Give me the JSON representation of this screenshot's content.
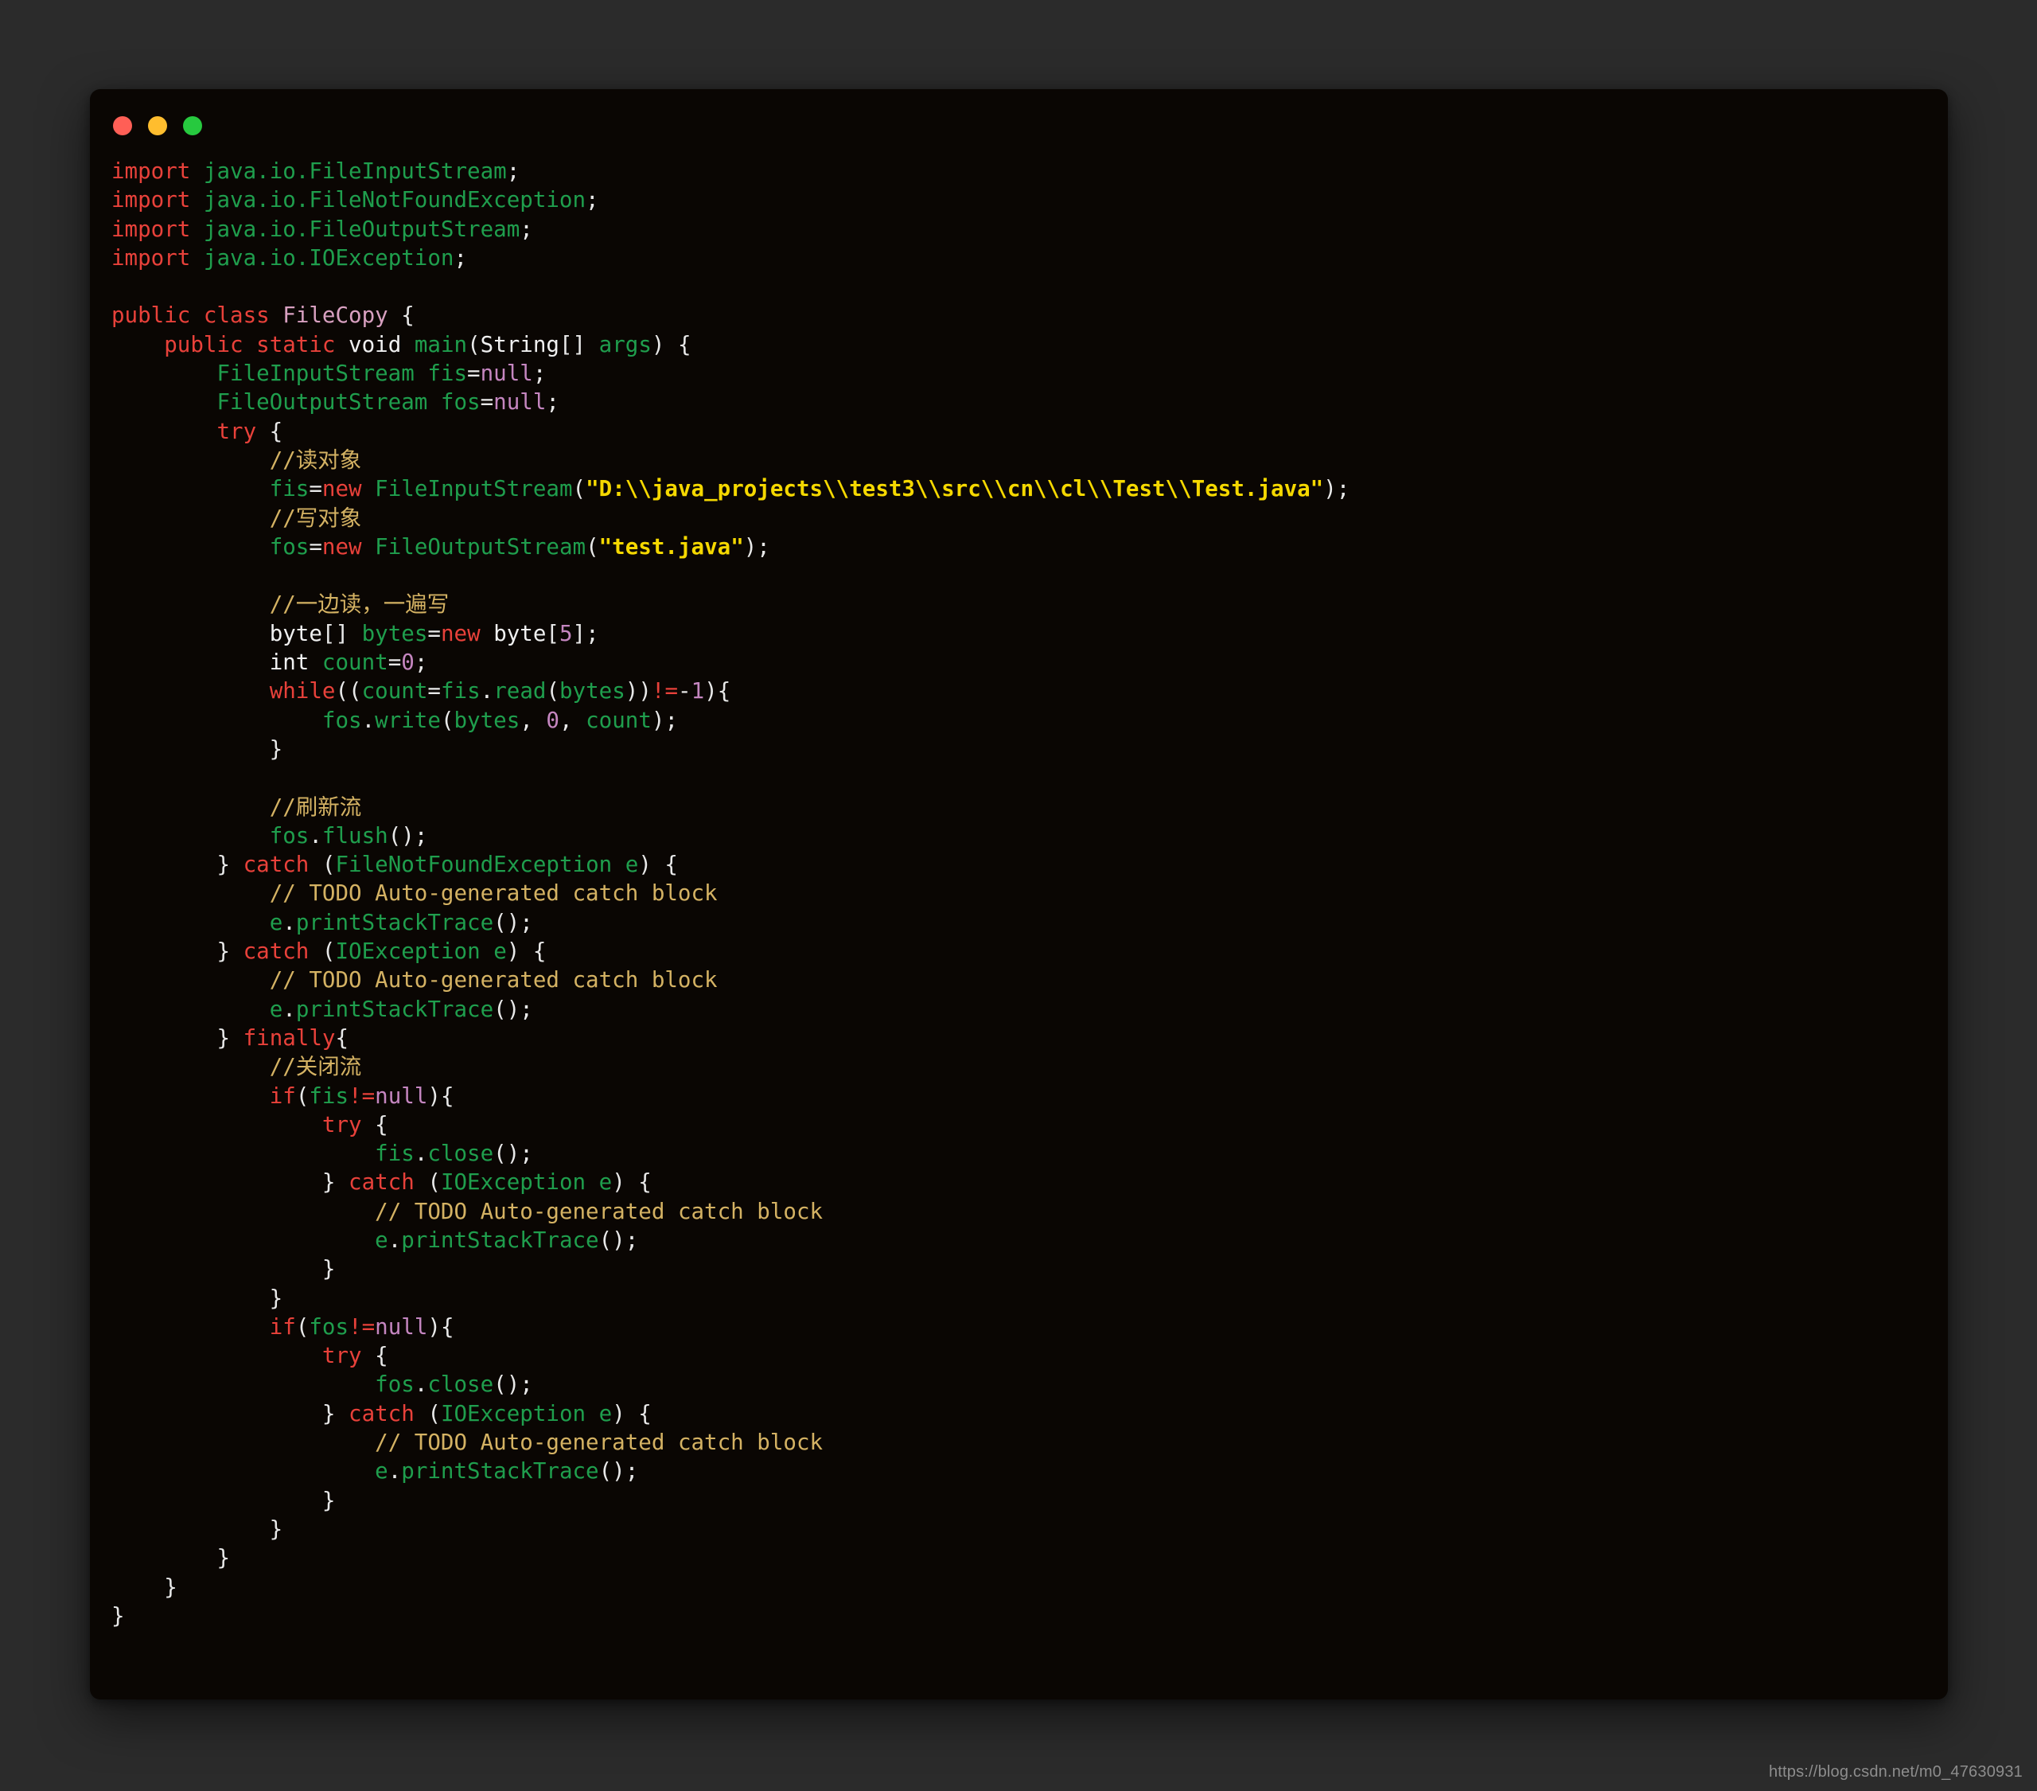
{
  "window": {
    "traffic_lights": [
      {
        "name": "close-button",
        "color": "#ff5f56"
      },
      {
        "name": "minimize-button",
        "color": "#ffbd2e"
      },
      {
        "name": "maximize-button",
        "color": "#27c93f"
      }
    ],
    "background": "#0a0603",
    "page_background": "#2b2b2b"
  },
  "watermark": {
    "text": "https://blog.csdn.net/m0_47630931"
  },
  "colors": {
    "keyword": "#e8413a",
    "type": "#1f9e4d",
    "class_name": "#d8a0c0",
    "string": "#f5d800",
    "number": "#c586c0",
    "comment": "#d4b263",
    "punctuation": "#e8e8e8",
    "primitive": "#f0f0f0"
  },
  "code": {
    "language": "java",
    "class_name": "FileCopy",
    "lines": [
      [
        {
          "t": "import",
          "c": "kw"
        },
        {
          "t": " ",
          "c": "pun"
        },
        {
          "t": "java.io.FileInputStream",
          "c": "typ"
        },
        {
          "t": ";",
          "c": "pun"
        }
      ],
      [
        {
          "t": "import",
          "c": "kw"
        },
        {
          "t": " ",
          "c": "pun"
        },
        {
          "t": "java.io.FileNotFoundException",
          "c": "typ"
        },
        {
          "t": ";",
          "c": "pun"
        }
      ],
      [
        {
          "t": "import",
          "c": "kw"
        },
        {
          "t": " ",
          "c": "pun"
        },
        {
          "t": "java.io.FileOutputStream",
          "c": "typ"
        },
        {
          "t": ";",
          "c": "pun"
        }
      ],
      [
        {
          "t": "import",
          "c": "kw"
        },
        {
          "t": " ",
          "c": "pun"
        },
        {
          "t": "java.io.IOException",
          "c": "typ"
        },
        {
          "t": ";",
          "c": "pun"
        }
      ],
      [],
      [
        {
          "t": "public",
          "c": "kw"
        },
        {
          "t": " ",
          "c": "pun"
        },
        {
          "t": "class",
          "c": "kw"
        },
        {
          "t": " ",
          "c": "pun"
        },
        {
          "t": "FileCopy",
          "c": "cls"
        },
        {
          "t": " {",
          "c": "pun"
        }
      ],
      [
        {
          "t": "    ",
          "c": "pun"
        },
        {
          "t": "public",
          "c": "kw"
        },
        {
          "t": " ",
          "c": "pun"
        },
        {
          "t": "static",
          "c": "kw"
        },
        {
          "t": " ",
          "c": "pun"
        },
        {
          "t": "void",
          "c": "prim"
        },
        {
          "t": " ",
          "c": "pun"
        },
        {
          "t": "main",
          "c": "typ"
        },
        {
          "t": "(",
          "c": "pun"
        },
        {
          "t": "String",
          "c": "prim"
        },
        {
          "t": "[] ",
          "c": "pun"
        },
        {
          "t": "args",
          "c": "typ"
        },
        {
          "t": ") {",
          "c": "pun"
        }
      ],
      [
        {
          "t": "        ",
          "c": "pun"
        },
        {
          "t": "FileInputStream",
          "c": "typ"
        },
        {
          "t": " ",
          "c": "pun"
        },
        {
          "t": "fis",
          "c": "typ"
        },
        {
          "t": "=",
          "c": "pun"
        },
        {
          "t": "null",
          "c": "num"
        },
        {
          "t": ";",
          "c": "pun"
        }
      ],
      [
        {
          "t": "        ",
          "c": "pun"
        },
        {
          "t": "FileOutputStream",
          "c": "typ"
        },
        {
          "t": " ",
          "c": "pun"
        },
        {
          "t": "fos",
          "c": "typ"
        },
        {
          "t": "=",
          "c": "pun"
        },
        {
          "t": "null",
          "c": "num"
        },
        {
          "t": ";",
          "c": "pun"
        }
      ],
      [
        {
          "t": "        ",
          "c": "pun"
        },
        {
          "t": "try",
          "c": "kw"
        },
        {
          "t": " {",
          "c": "pun"
        }
      ],
      [
        {
          "t": "            ",
          "c": "pun"
        },
        {
          "t": "//读对象",
          "c": "cmt"
        }
      ],
      [
        {
          "t": "            ",
          "c": "pun"
        },
        {
          "t": "fis",
          "c": "typ"
        },
        {
          "t": "=",
          "c": "pun"
        },
        {
          "t": "new",
          "c": "kw"
        },
        {
          "t": " ",
          "c": "pun"
        },
        {
          "t": "FileInputStream",
          "c": "typ"
        },
        {
          "t": "(",
          "c": "pun"
        },
        {
          "t": "\"D:\\\\java_projects\\\\test3\\\\src\\\\cn\\\\cl\\\\Test\\\\Test.java\"",
          "c": "str"
        },
        {
          "t": ");",
          "c": "pun"
        }
      ],
      [
        {
          "t": "            ",
          "c": "pun"
        },
        {
          "t": "//写对象",
          "c": "cmt"
        }
      ],
      [
        {
          "t": "            ",
          "c": "pun"
        },
        {
          "t": "fos",
          "c": "typ"
        },
        {
          "t": "=",
          "c": "pun"
        },
        {
          "t": "new",
          "c": "kw"
        },
        {
          "t": " ",
          "c": "pun"
        },
        {
          "t": "FileOutputStream",
          "c": "typ"
        },
        {
          "t": "(",
          "c": "pun"
        },
        {
          "t": "\"test.java\"",
          "c": "str"
        },
        {
          "t": ");",
          "c": "pun"
        }
      ],
      [],
      [
        {
          "t": "            ",
          "c": "pun"
        },
        {
          "t": "//一边读，一遍写",
          "c": "cmt"
        }
      ],
      [
        {
          "t": "            ",
          "c": "pun"
        },
        {
          "t": "byte",
          "c": "prim"
        },
        {
          "t": "[] ",
          "c": "pun"
        },
        {
          "t": "bytes",
          "c": "typ"
        },
        {
          "t": "=",
          "c": "pun"
        },
        {
          "t": "new",
          "c": "kw"
        },
        {
          "t": " ",
          "c": "pun"
        },
        {
          "t": "byte",
          "c": "prim"
        },
        {
          "t": "[",
          "c": "pun"
        },
        {
          "t": "5",
          "c": "num"
        },
        {
          "t": "];",
          "c": "pun"
        }
      ],
      [
        {
          "t": "            ",
          "c": "pun"
        },
        {
          "t": "int",
          "c": "prim"
        },
        {
          "t": " ",
          "c": "pun"
        },
        {
          "t": "count",
          "c": "typ"
        },
        {
          "t": "=",
          "c": "pun"
        },
        {
          "t": "0",
          "c": "num"
        },
        {
          "t": ";",
          "c": "pun"
        }
      ],
      [
        {
          "t": "            ",
          "c": "pun"
        },
        {
          "t": "while",
          "c": "kw"
        },
        {
          "t": "((",
          "c": "pun"
        },
        {
          "t": "count",
          "c": "typ"
        },
        {
          "t": "=",
          "c": "pun"
        },
        {
          "t": "fis",
          "c": "typ"
        },
        {
          "t": ".",
          "c": "pun"
        },
        {
          "t": "read",
          "c": "typ"
        },
        {
          "t": "(",
          "c": "pun"
        },
        {
          "t": "bytes",
          "c": "typ"
        },
        {
          "t": "))",
          "c": "pun"
        },
        {
          "t": "!=",
          "c": "kw"
        },
        {
          "t": "-",
          "c": "pun"
        },
        {
          "t": "1",
          "c": "num"
        },
        {
          "t": "){",
          "c": "pun"
        }
      ],
      [
        {
          "t": "                ",
          "c": "pun"
        },
        {
          "t": "fos",
          "c": "typ"
        },
        {
          "t": ".",
          "c": "pun"
        },
        {
          "t": "write",
          "c": "typ"
        },
        {
          "t": "(",
          "c": "pun"
        },
        {
          "t": "bytes",
          "c": "typ"
        },
        {
          "t": ", ",
          "c": "pun"
        },
        {
          "t": "0",
          "c": "num"
        },
        {
          "t": ", ",
          "c": "pun"
        },
        {
          "t": "count",
          "c": "typ"
        },
        {
          "t": ");",
          "c": "pun"
        }
      ],
      [
        {
          "t": "            }",
          "c": "pun"
        }
      ],
      [],
      [
        {
          "t": "            ",
          "c": "pun"
        },
        {
          "t": "//刷新流",
          "c": "cmt"
        }
      ],
      [
        {
          "t": "            ",
          "c": "pun"
        },
        {
          "t": "fos",
          "c": "typ"
        },
        {
          "t": ".",
          "c": "pun"
        },
        {
          "t": "flush",
          "c": "typ"
        },
        {
          "t": "();",
          "c": "pun"
        }
      ],
      [
        {
          "t": "        } ",
          "c": "pun"
        },
        {
          "t": "catch",
          "c": "kw"
        },
        {
          "t": " (",
          "c": "pun"
        },
        {
          "t": "FileNotFoundException",
          "c": "typ"
        },
        {
          "t": " ",
          "c": "pun"
        },
        {
          "t": "e",
          "c": "typ"
        },
        {
          "t": ") {",
          "c": "pun"
        }
      ],
      [
        {
          "t": "            ",
          "c": "pun"
        },
        {
          "t": "// TODO Auto-generated catch block",
          "c": "cmt"
        }
      ],
      [
        {
          "t": "            ",
          "c": "pun"
        },
        {
          "t": "e",
          "c": "typ"
        },
        {
          "t": ".",
          "c": "pun"
        },
        {
          "t": "printStackTrace",
          "c": "typ"
        },
        {
          "t": "();",
          "c": "pun"
        }
      ],
      [
        {
          "t": "        } ",
          "c": "pun"
        },
        {
          "t": "catch",
          "c": "kw"
        },
        {
          "t": " (",
          "c": "pun"
        },
        {
          "t": "IOException",
          "c": "typ"
        },
        {
          "t": " ",
          "c": "pun"
        },
        {
          "t": "e",
          "c": "typ"
        },
        {
          "t": ") {",
          "c": "pun"
        }
      ],
      [
        {
          "t": "            ",
          "c": "pun"
        },
        {
          "t": "// TODO Auto-generated catch block",
          "c": "cmt"
        }
      ],
      [
        {
          "t": "            ",
          "c": "pun"
        },
        {
          "t": "e",
          "c": "typ"
        },
        {
          "t": ".",
          "c": "pun"
        },
        {
          "t": "printStackTrace",
          "c": "typ"
        },
        {
          "t": "();",
          "c": "pun"
        }
      ],
      [
        {
          "t": "        } ",
          "c": "pun"
        },
        {
          "t": "finally",
          "c": "kw"
        },
        {
          "t": "{",
          "c": "pun"
        }
      ],
      [
        {
          "t": "            ",
          "c": "pun"
        },
        {
          "t": "//关闭流",
          "c": "cmt"
        }
      ],
      [
        {
          "t": "            ",
          "c": "pun"
        },
        {
          "t": "if",
          "c": "kw"
        },
        {
          "t": "(",
          "c": "pun"
        },
        {
          "t": "fis",
          "c": "typ"
        },
        {
          "t": "!=",
          "c": "kw"
        },
        {
          "t": "null",
          "c": "num"
        },
        {
          "t": "){",
          "c": "pun"
        }
      ],
      [
        {
          "t": "                ",
          "c": "pun"
        },
        {
          "t": "try",
          "c": "kw"
        },
        {
          "t": " {",
          "c": "pun"
        }
      ],
      [
        {
          "t": "                    ",
          "c": "pun"
        },
        {
          "t": "fis",
          "c": "typ"
        },
        {
          "t": ".",
          "c": "pun"
        },
        {
          "t": "close",
          "c": "typ"
        },
        {
          "t": "();",
          "c": "pun"
        }
      ],
      [
        {
          "t": "                } ",
          "c": "pun"
        },
        {
          "t": "catch",
          "c": "kw"
        },
        {
          "t": " (",
          "c": "pun"
        },
        {
          "t": "IOException",
          "c": "typ"
        },
        {
          "t": " ",
          "c": "pun"
        },
        {
          "t": "e",
          "c": "typ"
        },
        {
          "t": ") {",
          "c": "pun"
        }
      ],
      [
        {
          "t": "                    ",
          "c": "pun"
        },
        {
          "t": "// TODO Auto-generated catch block",
          "c": "cmt"
        }
      ],
      [
        {
          "t": "                    ",
          "c": "pun"
        },
        {
          "t": "e",
          "c": "typ"
        },
        {
          "t": ".",
          "c": "pun"
        },
        {
          "t": "printStackTrace",
          "c": "typ"
        },
        {
          "t": "();",
          "c": "pun"
        }
      ],
      [
        {
          "t": "                }",
          "c": "pun"
        }
      ],
      [
        {
          "t": "            }",
          "c": "pun"
        }
      ],
      [
        {
          "t": "            ",
          "c": "pun"
        },
        {
          "t": "if",
          "c": "kw"
        },
        {
          "t": "(",
          "c": "pun"
        },
        {
          "t": "fos",
          "c": "typ"
        },
        {
          "t": "!=",
          "c": "kw"
        },
        {
          "t": "null",
          "c": "num"
        },
        {
          "t": "){",
          "c": "pun"
        }
      ],
      [
        {
          "t": "                ",
          "c": "pun"
        },
        {
          "t": "try",
          "c": "kw"
        },
        {
          "t": " {",
          "c": "pun"
        }
      ],
      [
        {
          "t": "                    ",
          "c": "pun"
        },
        {
          "t": "fos",
          "c": "typ"
        },
        {
          "t": ".",
          "c": "pun"
        },
        {
          "t": "close",
          "c": "typ"
        },
        {
          "t": "();",
          "c": "pun"
        }
      ],
      [
        {
          "t": "                } ",
          "c": "pun"
        },
        {
          "t": "catch",
          "c": "kw"
        },
        {
          "t": " (",
          "c": "pun"
        },
        {
          "t": "IOException",
          "c": "typ"
        },
        {
          "t": " ",
          "c": "pun"
        },
        {
          "t": "e",
          "c": "typ"
        },
        {
          "t": ") {",
          "c": "pun"
        }
      ],
      [
        {
          "t": "                    ",
          "c": "pun"
        },
        {
          "t": "// TODO Auto-generated catch block",
          "c": "cmt"
        }
      ],
      [
        {
          "t": "                    ",
          "c": "pun"
        },
        {
          "t": "e",
          "c": "typ"
        },
        {
          "t": ".",
          "c": "pun"
        },
        {
          "t": "printStackTrace",
          "c": "typ"
        },
        {
          "t": "();",
          "c": "pun"
        }
      ],
      [
        {
          "t": "                }",
          "c": "pun"
        }
      ],
      [
        {
          "t": "            }",
          "c": "pun"
        }
      ],
      [
        {
          "t": "        }",
          "c": "pun"
        }
      ],
      [
        {
          "t": "    }",
          "c": "pun"
        }
      ],
      [
        {
          "t": "}",
          "c": "pun"
        }
      ]
    ]
  }
}
